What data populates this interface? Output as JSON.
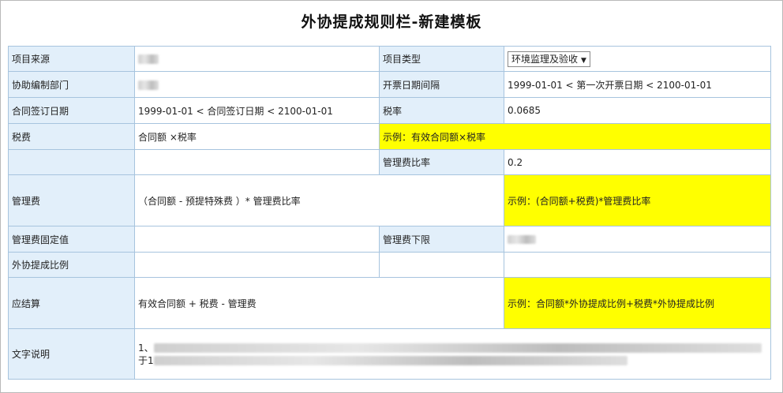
{
  "title": "外协提成规则栏-新建模板",
  "rows": {
    "project_source": {
      "label": "项目来源"
    },
    "project_type": {
      "label": "项目类型",
      "selected": "环境监理及验收",
      "arrow": "▼"
    },
    "assist_dept": {
      "label": "协助编制部门"
    },
    "invoice_interval": {
      "label": "开票日期间隔",
      "value": "1999-01-01 < 第一次开票日期 < 2100-01-01"
    },
    "sign_date": {
      "label": "合同签订日期",
      "value": "1999-01-01 < 合同签订日期 < 2100-01-01"
    },
    "tax_rate": {
      "label": "税率",
      "value": "0.0685"
    },
    "tax_fee": {
      "label": "税费",
      "formula": "合同额 ×税率",
      "example": "示例：有效合同额×税率"
    },
    "mgmt_rate": {
      "label": "管理费比率",
      "value": "0.2"
    },
    "mgmt_fee": {
      "label": "管理费",
      "formula": "（合同额 - 预提特殊费 ）* 管理费比率",
      "example": "示例：(合同额+税费)*管理费比率"
    },
    "mgmt_fixed": {
      "label": "管理费固定值"
    },
    "mgmt_lower": {
      "label": "管理费下限"
    },
    "outsource_ratio": {
      "label": "外协提成比例"
    },
    "settlement": {
      "label": "应结算",
      "formula": "有效合同额 + 税费 - 管理费",
      "example": "示例：合同额*外协提成比例+税费*外协提成比例"
    },
    "description": {
      "label": "文字说明",
      "prefix1": "1、",
      "prefix2": "于1"
    }
  }
}
